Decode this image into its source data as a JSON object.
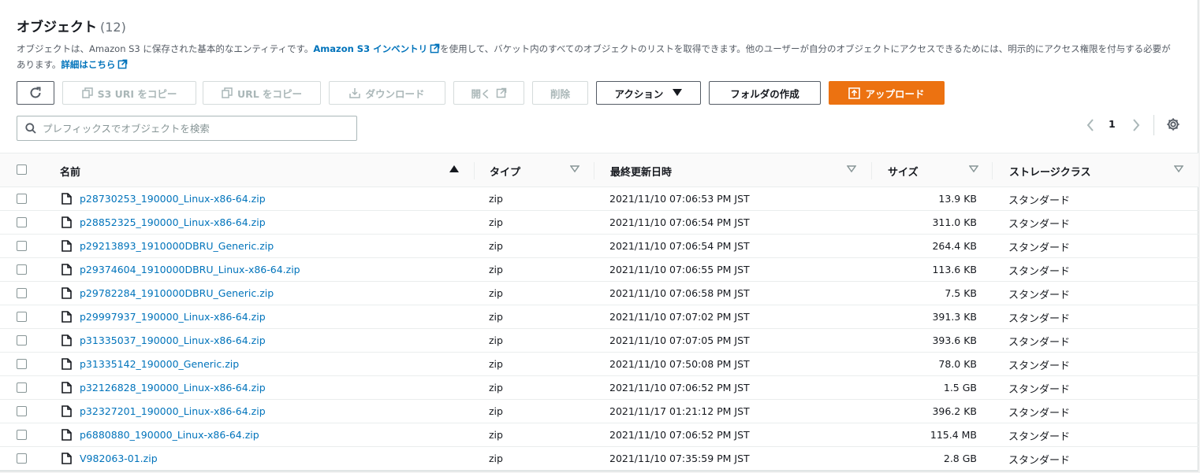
{
  "header": {
    "title": "オブジェクト",
    "count": "(12)"
  },
  "description": {
    "text1": "オブジェクトは、Amazon S3 に保存された基本的なエンティティです。",
    "link1": "Amazon S3 インベントリ",
    "text2": "を使用して、バケット内のすべてのオブジェクトのリストを取得できます。他のユーザーが自分のオブジェクトにアクセスできるためには、明示的にアクセス権限を付与する必要があります。",
    "link2": "詳細はこちら"
  },
  "toolbar": {
    "copy_s3_uri": "S3 URI をコピー",
    "copy_url": "URL をコピー",
    "download": "ダウンロード",
    "open": "開く",
    "delete": "削除",
    "actions": "アクション",
    "create_folder": "フォルダの作成",
    "upload": "アップロード"
  },
  "search": {
    "placeholder": "プレフィックスでオブジェクトを検索"
  },
  "pagination": {
    "current_page": "1"
  },
  "table": {
    "columns": {
      "name": "名前",
      "type": "タイプ",
      "modified": "最終更新日時",
      "size": "サイズ",
      "storage_class": "ストレージクラス"
    },
    "rows": [
      {
        "name": "p28730253_190000_Linux-x86-64.zip",
        "type": "zip",
        "modified": "2021/11/10 07:06:53 PM JST",
        "size": "13.9 KB",
        "storage_class": "スタンダード"
      },
      {
        "name": "p28852325_190000_Linux-x86-64.zip",
        "type": "zip",
        "modified": "2021/11/10 07:06:54 PM JST",
        "size": "311.0 KB",
        "storage_class": "スタンダード"
      },
      {
        "name": "p29213893_1910000DBRU_Generic.zip",
        "type": "zip",
        "modified": "2021/11/10 07:06:54 PM JST",
        "size": "264.4 KB",
        "storage_class": "スタンダード"
      },
      {
        "name": "p29374604_1910000DBRU_Linux-x86-64.zip",
        "type": "zip",
        "modified": "2021/11/10 07:06:55 PM JST",
        "size": "113.6 KB",
        "storage_class": "スタンダード"
      },
      {
        "name": "p29782284_1910000DBRU_Generic.zip",
        "type": "zip",
        "modified": "2021/11/10 07:06:58 PM JST",
        "size": "7.5 KB",
        "storage_class": "スタンダード"
      },
      {
        "name": "p29997937_190000_Linux-x86-64.zip",
        "type": "zip",
        "modified": "2021/11/10 07:07:02 PM JST",
        "size": "391.3 KB",
        "storage_class": "スタンダード"
      },
      {
        "name": "p31335037_190000_Linux-x86-64.zip",
        "type": "zip",
        "modified": "2021/11/10 07:07:05 PM JST",
        "size": "393.6 KB",
        "storage_class": "スタンダード"
      },
      {
        "name": "p31335142_190000_Generic.zip",
        "type": "zip",
        "modified": "2021/11/10 07:50:08 PM JST",
        "size": "78.0 KB",
        "storage_class": "スタンダード"
      },
      {
        "name": "p32126828_190000_Linux-x86-64.zip",
        "type": "zip",
        "modified": "2021/11/10 07:06:52 PM JST",
        "size": "1.5 GB",
        "storage_class": "スタンダード"
      },
      {
        "name": "p32327201_190000_Linux-x86-64.zip",
        "type": "zip",
        "modified": "2021/11/17 01:21:12 PM JST",
        "size": "396.2 KB",
        "storage_class": "スタンダード"
      },
      {
        "name": "p6880880_190000_Linux-x86-64.zip",
        "type": "zip",
        "modified": "2021/11/10 07:06:52 PM JST",
        "size": "115.4 MB",
        "storage_class": "スタンダード"
      },
      {
        "name": "V982063-01.zip",
        "type": "zip",
        "modified": "2021/11/10 07:35:59 PM JST",
        "size": "2.8 GB",
        "storage_class": "スタンダード"
      }
    ]
  },
  "colors": {
    "link": "#0073bb",
    "primary": "#ec7211",
    "border": "#aab7b8",
    "text": "#16191f"
  }
}
